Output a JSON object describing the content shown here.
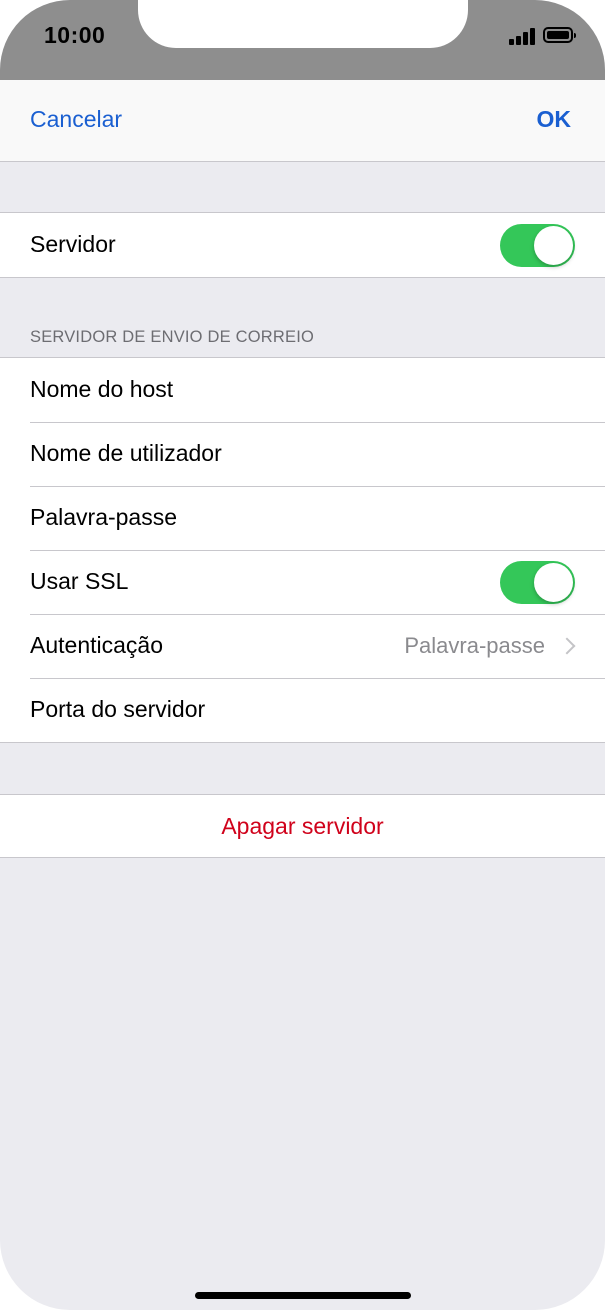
{
  "status_bar": {
    "time": "10:00"
  },
  "nav": {
    "cancel_label": "Cancelar",
    "ok_label": "OK"
  },
  "server_group": {
    "server_label": "Servidor",
    "server_toggle_on": true
  },
  "outgoing": {
    "section_title": "SERVIDOR DE ENVIO DE CORREIO",
    "host_label": "Nome do host",
    "username_label": "Nome de utilizador",
    "password_label": "Palavra-passe",
    "ssl_label": "Usar SSL",
    "ssl_toggle_on": true,
    "auth_label": "Autenticação",
    "auth_value": "Palavra-passe",
    "port_label": "Porta do servidor"
  },
  "delete": {
    "label": "Apagar servidor"
  },
  "colors": {
    "accent": "#1a5fd1",
    "toggle_on": "#34c759",
    "destructive": "#d0021b",
    "background": "#ebebf0"
  },
  "icons": {
    "chevron": "chevron-right-icon",
    "signal": "signal-bars-icon",
    "battery": "battery-icon"
  }
}
